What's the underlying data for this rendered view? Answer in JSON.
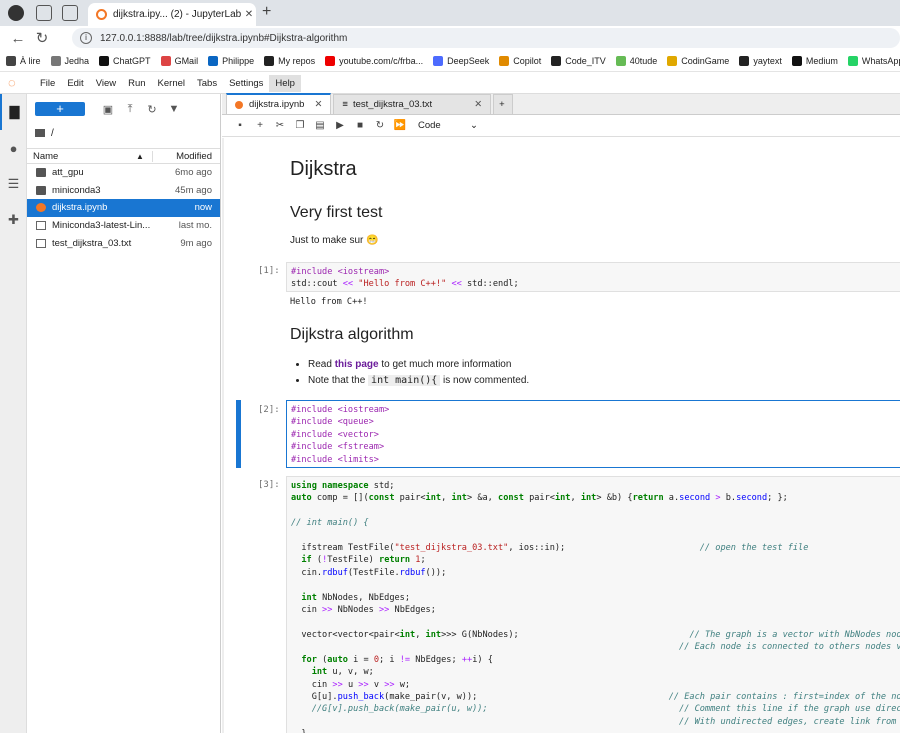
{
  "browser": {
    "tab_title": "dijkstra.ipy... (2) - JupyterLab",
    "url": "127.0.0.1:8888/lab/tree/dijkstra.ipynb#Dijkstra-algorithm",
    "bookmarks": [
      "À lire",
      "Jedha",
      "ChatGPT",
      "GMail",
      "Philippe",
      "My repos",
      "youtube.com/c/frba...",
      "DeepSeek",
      "Copilot",
      "Code_ITV",
      "40tude",
      "CodinGame",
      "yaytext",
      "Medium",
      "WhatsApp"
    ],
    "bookmark_colors": [
      "#444",
      "#777",
      "#111",
      "#d44",
      "#0a66c2",
      "#222",
      "#e00",
      "#4d6bfe",
      "#e08a00",
      "#222",
      "#6b5",
      "#e0a800",
      "#222",
      "#111",
      "#25d366"
    ]
  },
  "menu": [
    "File",
    "Edit",
    "View",
    "Run",
    "Kernel",
    "Tabs",
    "Settings",
    "Help"
  ],
  "filebrowser": {
    "new_label": "+",
    "path": "/",
    "col_name": "Name",
    "col_modified": "Modified",
    "files": [
      {
        "name": "att_gpu",
        "mod": "6mo ago",
        "type": "folder"
      },
      {
        "name": "miniconda3",
        "mod": "45m ago",
        "type": "folder"
      },
      {
        "name": "dijkstra.ipynb",
        "mod": "now",
        "type": "nb"
      },
      {
        "name": "Miniconda3-latest-Lin...",
        "mod": "last mo.",
        "type": "file"
      },
      {
        "name": "test_dijkstra_03.txt",
        "mod": "9m ago",
        "type": "file"
      }
    ]
  },
  "tabs": [
    {
      "label": "dijkstra.ipynb"
    },
    {
      "label": "test_dijkstra_03.txt"
    }
  ],
  "toolbar": {
    "celltype": "Code"
  },
  "nb": {
    "h1": "Dijkstra",
    "h2a": "Very first test",
    "p1": "Just to make sur 😁",
    "p1_cell": "[1]:",
    "out1": "Hello from C++!",
    "h2b": "Dijkstra algorithm",
    "li1a": "Read ",
    "li1b": "this page",
    "li1c": " to get much more information",
    "li2a": "Note that the ",
    "li2b": "int main(){",
    "li2c": " is now commented.",
    "p2_cell": "[2]:",
    "p3_cell": "[3]:"
  }
}
